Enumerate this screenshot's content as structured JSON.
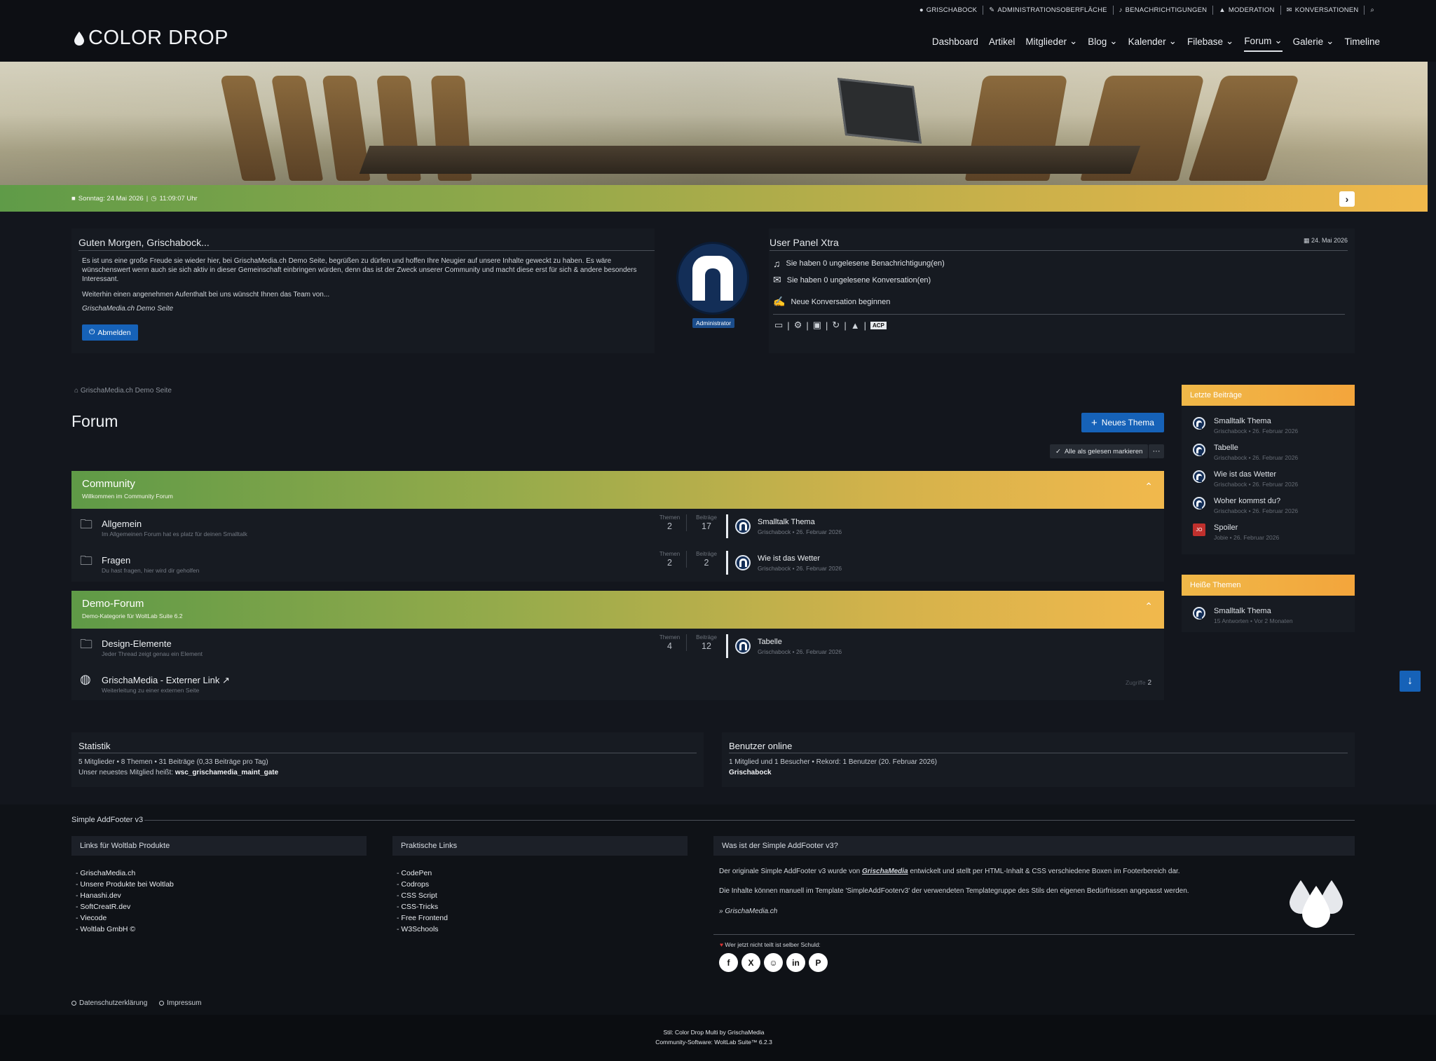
{
  "userbar": {
    "items": [
      "Grischabock",
      "Administrationsoberfläche",
      "Benachrichtigungen",
      "Moderation",
      "Konversationen"
    ]
  },
  "logo": {
    "text": "COLOR DROP"
  },
  "nav": {
    "items": [
      {
        "label": "Dashboard"
      },
      {
        "label": "Artikel"
      },
      {
        "label": "Mitglieder"
      },
      {
        "label": "Blog"
      },
      {
        "label": "Kalender"
      },
      {
        "label": "Filebase"
      },
      {
        "label": "Forum"
      },
      {
        "label": "Galerie"
      },
      {
        "label": "Timeline"
      }
    ]
  },
  "hero": {
    "date": "Sonntag: 24 Mai 2026",
    "time": "11:09:07 Uhr"
  },
  "welcome": {
    "title": "Guten Morgen, Grischabock...",
    "p1": "Es ist uns eine große Freude sie wieder hier, bei GrischaMedia.ch Demo Seite, begrüßen zu dürfen und hoffen Ihre Neugier auf unsere Inhalte geweckt zu haben. Es wäre wünschenswert wenn auch sie sich aktiv in dieser Gemeinschaft einbringen würden, denn das ist der Zweck unserer Community und macht diese erst für sich & andere besonders Interessant.",
    "p2": "Weiterhin einen angenehmen Aufenthalt bei uns wünscht Ihnen das Team von...",
    "sign": "GrischaMedia.ch Demo Seite",
    "logout": "Abmelden",
    "role": "Administrator"
  },
  "userpanel": {
    "title": "User Panel Xtra",
    "date": "24. Mai 2026",
    "notif": "Sie haben 0 ungelesene Benachrichtigung(en)",
    "conv": "Sie haben 0 ungelesene Konversation(en)",
    "newconv": "Neue Konversation beginnen",
    "acp": "ACP"
  },
  "breadcrumb": "GrischaMedia.ch Demo Seite",
  "forum": {
    "title": "Forum",
    "new_topic": "Neues Thema",
    "mark_read": "Alle als gelesen markieren",
    "more": "···",
    "label_topics": "Themen",
    "label_posts": "Beiträge",
    "categories": [
      {
        "name": "Community",
        "sub": "Willkommen im Community Forum",
        "boards": [
          {
            "name": "Allgemein",
            "desc": "Im Allgemeinen Forum hat es platz für deinen Smalltalk",
            "topics": "2",
            "posts": "17",
            "last_title": "Smalltalk Thema",
            "last_meta": "Grischabock • 26. Februar 2026"
          },
          {
            "name": "Fragen",
            "desc": "Du hast fragen, hier wird dir geholfen",
            "topics": "2",
            "posts": "2",
            "last_title": "Wie ist das Wetter",
            "last_meta": "Grischabock • 26. Februar 2026"
          }
        ]
      },
      {
        "name": "Demo-Forum",
        "sub": "Demo-Kategorie für WoltLab Suite 6.2",
        "boards": [
          {
            "name": "Design-Elemente",
            "desc": "Jeder Thread zeigt genau ein Element",
            "topics": "4",
            "posts": "12",
            "last_title": "Tabelle",
            "last_meta": "Grischabock • 26. Februar 2026"
          }
        ]
      }
    ],
    "extlink": {
      "name": "GrischaMedia - Externer Link ↗",
      "desc": "Weiterleitung zu einer externen Seite",
      "hits_label": "Zugriffe",
      "hits": "2"
    }
  },
  "sidebar": {
    "recent_title": "Letzte Beiträge",
    "recent": [
      {
        "title": "Smalltalk Thema",
        "meta": "Grischabock • 26. Februar 2026"
      },
      {
        "title": "Tabelle",
        "meta": "Grischabock • 26. Februar 2026"
      },
      {
        "title": "Wie ist das Wetter",
        "meta": "Grischabock • 26. Februar 2026"
      },
      {
        "title": "Woher kommst du?",
        "meta": "Grischabock • 26. Februar 2026"
      },
      {
        "title": "Spoiler",
        "meta": "Jobie • 26. Februar 2026",
        "initials": "JO"
      }
    ],
    "hot_title": "Heiße Themen",
    "hot": [
      {
        "title": "Smalltalk Thema",
        "meta": "15 Antworten • Vor 2 Monaten"
      }
    ]
  },
  "stats": {
    "title": "Statistik",
    "line1": "5 Mitglieder  •  8 Themen  •  31 Beiträge (0,33 Beiträge pro Tag)",
    "line2_prefix": "Unser neuestes Mitglied heißt:",
    "line2_name": "wsc_grischamedia_maint_gate"
  },
  "online": {
    "title": "Benutzer online",
    "line1": "1 Mitglied und 1 Besucher  •  Rekord: 1 Benutzer (20. Februar 2026)",
    "user": "Grischabock"
  },
  "footer": {
    "title": "Simple AddFooter v3",
    "col1_title": "Links für Woltlab Produkte",
    "col1": [
      "GrischaMedia.ch",
      "Unsere Produkte bei Woltlab",
      "Hanashi.dev",
      "SoftCreatR.dev",
      "Viecode",
      "Woltlab GmbH ©"
    ],
    "col2_title": "Praktische Links",
    "col2": [
      "CodePen",
      "Codrops",
      "CSS Script",
      "CSS-Tricks",
      "Free Frontend",
      "W3Schools"
    ],
    "col3_title": "Was ist der Simple AddFooter v3?",
    "col3_p1a": "Der originale Simple AddFooter v3 wurde von",
    "col3_p1b": "GrischaMedia",
    "col3_p1c": "entwickelt und stellt per HTML-Inhalt & CSS verschiedene Boxen im Footerbereich dar.",
    "col3_p2": "Die Inhalte können manuell im Template 'SimpleAddFooterv3' der verwendeten Templategruppe des Stils den eigenen Bedürfnissen angepasst werden.",
    "col3_sign": "» GrischaMedia.ch",
    "share_label": "Wer jetzt nicht teilt ist selber Schuld:",
    "legal1": "Datenschutzerklärung",
    "legal2": "Impressum",
    "credit1": "Stil: Color Drop Multi by GrischaMedia",
    "credit2": "Community-Software: WoltLab Suite™ 6.2.3"
  },
  "colors": {
    "accent_blue": "#1662b8",
    "green": "#5f9b48",
    "orange": "#f0b84b"
  }
}
